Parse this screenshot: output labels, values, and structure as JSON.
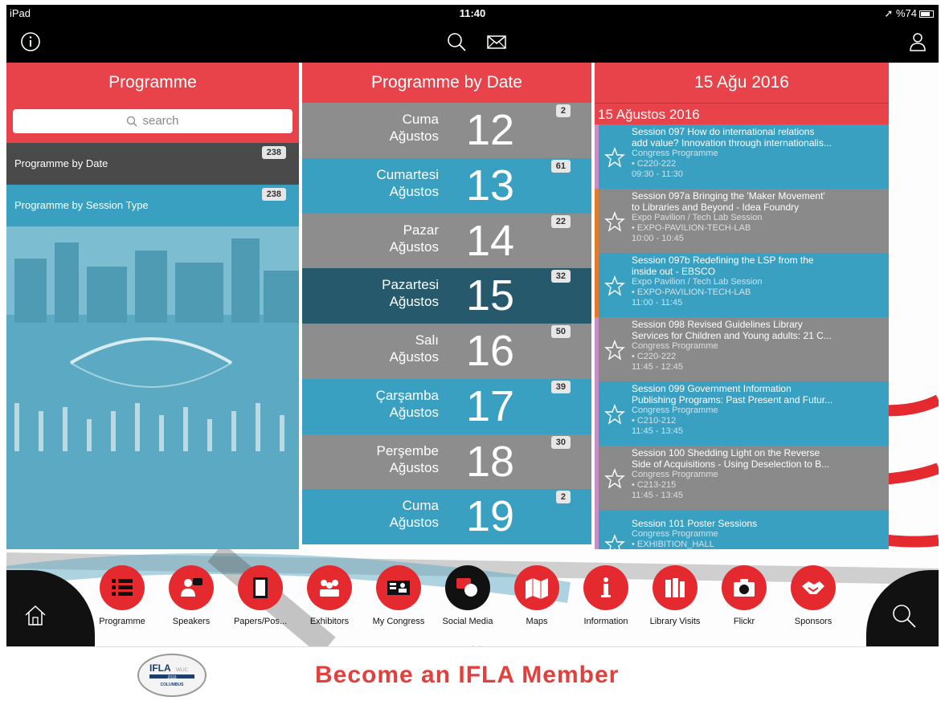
{
  "status_bar": {
    "device": "iPad",
    "time": "11:40",
    "battery": "%74"
  },
  "nav_icons": [
    "info-icon",
    "search-icon",
    "mail-icon",
    "user-icon"
  ],
  "col1": {
    "header": "Programme",
    "search_placeholder": "search",
    "items": [
      {
        "label": "Programme by Date",
        "count": "238"
      },
      {
        "label": "Programme by Session Type",
        "count": "238"
      }
    ]
  },
  "col2": {
    "header": "Programme by Date",
    "dates": [
      {
        "day": "Cuma",
        "month": "Ağustos",
        "num": "12",
        "count": "2"
      },
      {
        "day": "Cumartesi",
        "month": "Ağustos",
        "num": "13",
        "count": "61"
      },
      {
        "day": "Pazar",
        "month": "Ağustos",
        "num": "14",
        "count": "22"
      },
      {
        "day": "Pazartesi",
        "month": "Ağustos",
        "num": "15",
        "count": "32"
      },
      {
        "day": "Salı",
        "month": "Ağustos",
        "num": "16",
        "count": "50"
      },
      {
        "day": "Çarşamba",
        "month": "Ağustos",
        "num": "17",
        "count": "39"
      },
      {
        "day": "Perşembe",
        "month": "Ağustos",
        "num": "18",
        "count": "30"
      },
      {
        "day": "Cuma",
        "month": "Ağustos",
        "num": "19",
        "count": "2"
      }
    ]
  },
  "col3": {
    "header": "15 Ağu 2016",
    "subheader": "15 Ağustos 2016",
    "sessions": [
      {
        "l1": "Session 097 How do international relations",
        "l2": "add value? Innovation through internationalis...",
        "track": "Congress Programme",
        "room": "• C220-222",
        "time": "09:30 - 11:30"
      },
      {
        "l1": "Session 097a Bringing the 'Maker Movement'",
        "l2": "to Libraries and Beyond - Idea Foundry",
        "track": "Expo Pavilion / Tech Lab Session",
        "room": "• EXPO-PAVILION-TECH-LAB",
        "time": "10:00 - 10:45"
      },
      {
        "l1": "Session 097b Redefining the LSP from the",
        "l2": "inside out - EBSCO",
        "track": "Expo Pavilion / Tech Lab Session",
        "room": "• EXPO-PAVILION-TECH-LAB",
        "time": "11:00 - 11:45"
      },
      {
        "l1": "Session 098 Revised Guidelines Library",
        "l2": "Services for Children and Young adults: 21 C...",
        "track": "Congress Programme",
        "room": "• C220-222",
        "time": "11:45 - 12:45"
      },
      {
        "l1": "Session 099 Government Information",
        "l2": "Publishing Programs: Past Present and Futur...",
        "track": "Congress Programme",
        "room": "• C210-212",
        "time": "11:45 - 13:45"
      },
      {
        "l1": "Session 100 Shedding Light on the Reverse",
        "l2": "Side of Acquisitions - Using Deselection to B...",
        "track": "Congress Programme",
        "room": "• C213-215",
        "time": "11:45 - 13:45"
      },
      {
        "l1": "Session 101 Poster Sessions",
        "l2": "",
        "track": "Congress Programme",
        "room": "• EXHIBITION_HALL",
        "time": ""
      }
    ]
  },
  "dock": [
    {
      "label": "Programme",
      "icon": "list-icon"
    },
    {
      "label": "Speakers",
      "icon": "speaker-icon"
    },
    {
      "label": "Papers/Pos...",
      "icon": "papers-icon"
    },
    {
      "label": "Exhibitors",
      "icon": "exhibitors-icon"
    },
    {
      "label": "My Congress",
      "icon": "my-congress-icon"
    },
    {
      "label": "Social Media",
      "icon": "chat-icon"
    },
    {
      "label": "Maps",
      "icon": "map-icon"
    },
    {
      "label": "Information",
      "icon": "info-icon"
    },
    {
      "label": "Library Visits",
      "icon": "books-icon"
    },
    {
      "label": "Flickr",
      "icon": "camera-icon"
    },
    {
      "label": "Sponsors",
      "icon": "handshake-icon"
    }
  ],
  "footer": {
    "logo_text": "IFLA WLIC 2016 COLUMBUS",
    "banner": "Become an IFLA Member"
  },
  "colors": {
    "accent_red": "#e8424a",
    "blue": "#3aa0c2",
    "dark_teal": "#25596b",
    "gray": "#8d8d8d"
  }
}
